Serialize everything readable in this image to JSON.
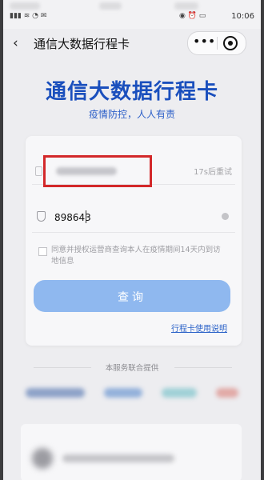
{
  "status_bar": {
    "time": "10:06"
  },
  "nav": {
    "title": "通信大数据行程卡",
    "more_glyph": "•••"
  },
  "hero": {
    "title": "通信大数据行程卡",
    "subtitle": "疫情防控，人人有责"
  },
  "form": {
    "phone_value": "",
    "resend_label": "17s后重试",
    "code_value": "898643",
    "consent_text": "同意并授权运营商查询本人在疫情期间14天内到访地信息",
    "query_button": "查询",
    "guide_link": "行程卡使用说明"
  },
  "footer": {
    "provider_label": "本服务联合提供"
  },
  "colors": {
    "title_blue": "#1a4fbd",
    "button_blue": "#8fb8ef",
    "highlight_red": "#d3282a"
  }
}
